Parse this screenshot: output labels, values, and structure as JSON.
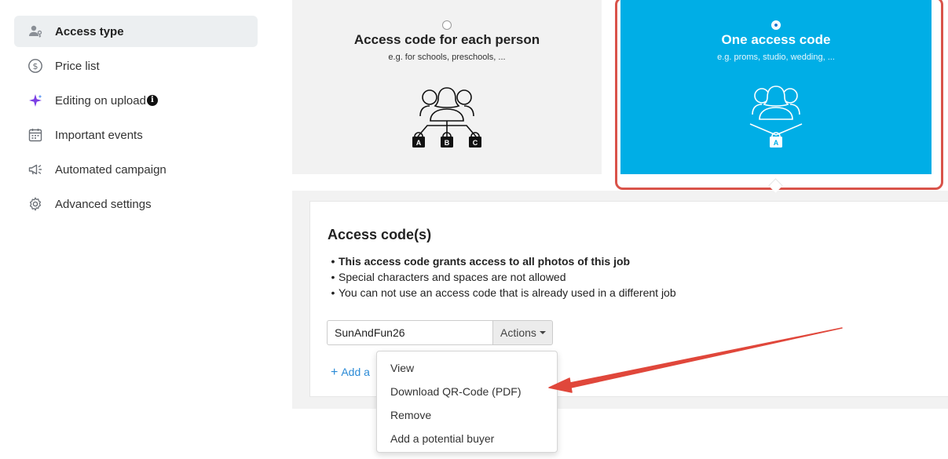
{
  "sidebar": {
    "items": [
      {
        "label": "Access type",
        "icon": "user-key-icon",
        "active": true
      },
      {
        "label": "Price list",
        "icon": "dollar-circle-icon"
      },
      {
        "label": "Editing on upload",
        "icon": "sparkle-icon"
      },
      {
        "label": "Important events",
        "icon": "calendar-icon"
      },
      {
        "label": "Automated campaign",
        "icon": "megaphone-icon"
      },
      {
        "label": "Advanced settings",
        "icon": "gear-icon"
      }
    ],
    "info_badge": "i"
  },
  "access_types": [
    {
      "title": "Access code for each person",
      "subtitle": "e.g. for schools, preschools, ...",
      "selected": false,
      "lock_labels": [
        "A",
        "B",
        "C"
      ]
    },
    {
      "title": "One access code",
      "subtitle": "e.g. proms, studio, wedding, ...",
      "selected": true,
      "lock_labels": [
        "A"
      ]
    }
  ],
  "access_codes": {
    "title": "Access code(s)",
    "rules": [
      "This access code grants access to all photos of this job",
      "Special characters and spaces are not allowed",
      "You can not use an access code that is already used in a different job"
    ],
    "code_value": "SunAndFun26",
    "actions_label": "Actions",
    "add_label": "Add a"
  },
  "actions_menu": {
    "items": [
      "View",
      "Download QR-Code (PDF)",
      "Remove",
      "Add a potential buyer"
    ]
  },
  "colors": {
    "selected_card": "#00aee6",
    "highlight": "#d9534a",
    "link": "#2a8ad6",
    "sparkle": "#7b3fe4"
  }
}
